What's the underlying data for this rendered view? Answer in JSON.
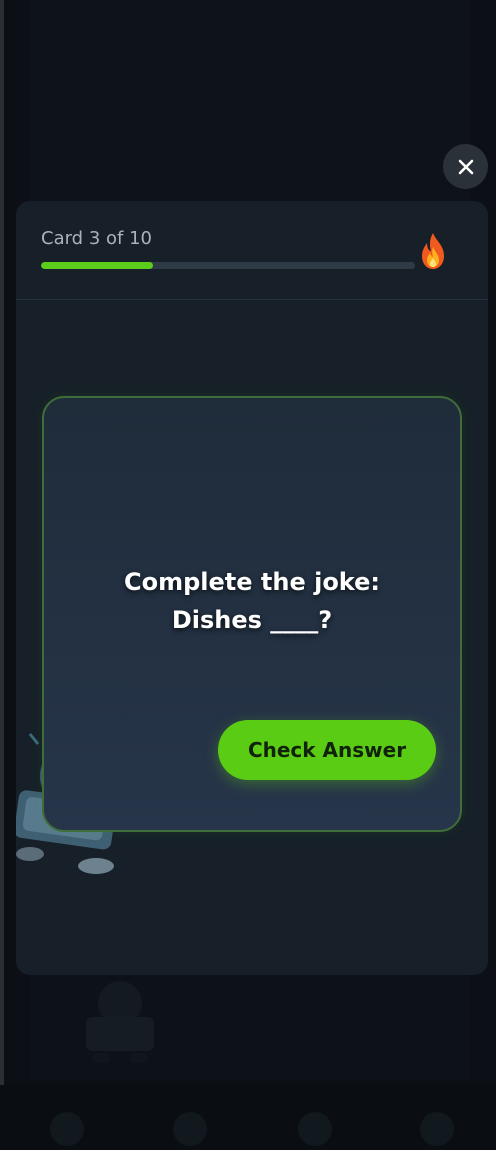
{
  "modal": {
    "card_counter": "Card 3 of 10",
    "progress": 0.3,
    "streak_icon": "fire-icon",
    "close_icon": "close-icon"
  },
  "flashcard": {
    "question_line1": "Complete the joke:",
    "question_line2": "Dishes ____?",
    "check_answer_label": "Check Answer"
  },
  "colors": {
    "accent_green": "#5bcc14",
    "progress_track": "#2e3a45",
    "modal_bg": "#172028",
    "card_border": "#3f6e3a"
  }
}
